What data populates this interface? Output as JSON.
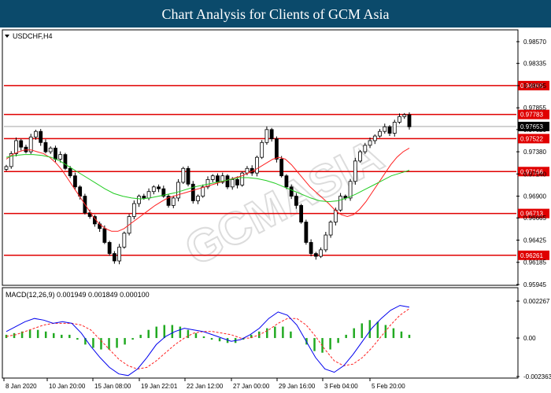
{
  "header": {
    "title": "Chart Analysis for Clients of GCM Asia"
  },
  "watermark": "GCMASIA",
  "colors": {
    "header_bg": "#0b4a6b",
    "level_line": "#e00000",
    "ma_fast": "#ff2020",
    "ma_slow": "#22cc22",
    "signal": "#ff2020",
    "macd_line": "#0000ee",
    "histogram": "#22aa22",
    "candle_up": "#ffffff",
    "candle_down": "#000000"
  },
  "chart_data": [
    {
      "type": "candlestick",
      "symbol_label": "USDCHF,H4",
      "ylim": [
        0.95945,
        0.9857
      ],
      "price_ticks": [
        0.9857,
        0.98335,
        0.98095,
        0.97855,
        0.9762,
        0.9738,
        0.9714,
        0.969,
        0.96665,
        0.96425,
        0.96185,
        0.95945
      ],
      "price_tick_labels": [
        "0.98570",
        "0.98335",
        "0.98095",
        "0.97855",
        "0.97620",
        "0.97380",
        "0.97140",
        "0.96900",
        "0.96665",
        "0.96425",
        "0.96185",
        "0.95945"
      ],
      "levels": [
        {
          "value": 0.98095,
          "label": "0.98095"
        },
        {
          "value": 0.97783,
          "label": "0.97783"
        },
        {
          "value": 0.97522,
          "label": "0.97522"
        },
        {
          "value": 0.97166,
          "label": "0.97166"
        },
        {
          "value": 0.96713,
          "label": "0.96713"
        },
        {
          "value": 0.96261,
          "label": "0.96261"
        }
      ],
      "current_price": {
        "value": 0.97653,
        "label": "0.97653"
      },
      "x_labels": [
        "8 Jan 2020",
        "10 Jan 20:00",
        "15 Jan 08:00",
        "19 Jan 22:01",
        "22 Jan 12:00",
        "27 Jan 00:00",
        "29 Jan 16:00",
        "3 Feb 04:00",
        "5 Feb 20:00"
      ],
      "close_path": [
        0.9722,
        0.9736,
        0.975,
        0.9743,
        0.9738,
        0.9754,
        0.976,
        0.9748,
        0.9738,
        0.9742,
        0.973,
        0.9735,
        0.972,
        0.9712,
        0.97,
        0.969,
        0.9672,
        0.9668,
        0.966,
        0.9655,
        0.964,
        0.9628,
        0.962,
        0.9635,
        0.965,
        0.9668,
        0.9682,
        0.969,
        0.9688,
        0.9695,
        0.97,
        0.9698,
        0.969,
        0.968,
        0.9688,
        0.9705,
        0.972,
        0.9703,
        0.9685,
        0.969,
        0.97,
        0.9708,
        0.9712,
        0.9705,
        0.9712,
        0.97,
        0.9708,
        0.9702,
        0.9715,
        0.972,
        0.9715,
        0.9732,
        0.9748,
        0.9762,
        0.9752,
        0.973,
        0.9712,
        0.97,
        0.969,
        0.968,
        0.9662,
        0.964,
        0.9628,
        0.9625,
        0.9632,
        0.9648,
        0.9662,
        0.9675,
        0.969,
        0.9688,
        0.9706,
        0.9728,
        0.9738,
        0.9745,
        0.975,
        0.9755,
        0.976,
        0.9765,
        0.9758,
        0.977,
        0.9776,
        0.9778,
        0.9765
      ],
      "ma_fast": [
        0.973,
        0.9735,
        0.9738,
        0.974,
        0.974,
        0.9738,
        0.9736,
        0.9732,
        0.9726,
        0.9718,
        0.9708,
        0.9698,
        0.9688,
        0.9678,
        0.9668,
        0.966,
        0.9655,
        0.9652,
        0.9652,
        0.9655,
        0.966,
        0.9665,
        0.967,
        0.9675,
        0.968,
        0.9684,
        0.9688,
        0.969,
        0.9692,
        0.9694,
        0.9696,
        0.9698,
        0.97,
        0.9702,
        0.9704,
        0.9706,
        0.9708,
        0.971,
        0.9712,
        0.9715,
        0.9718,
        0.9722,
        0.9726,
        0.973,
        0.9732,
        0.973,
        0.9724,
        0.9716,
        0.9708,
        0.97,
        0.9694,
        0.9688,
        0.9682,
        0.9675,
        0.967,
        0.9668,
        0.967,
        0.9676,
        0.9684,
        0.9694,
        0.9704,
        0.9714,
        0.9724,
        0.9732,
        0.9738,
        0.9742
      ],
      "ma_slow": [
        0.9732,
        0.9734,
        0.9735,
        0.9735,
        0.9734,
        0.9732,
        0.9728,
        0.9722,
        0.9716,
        0.971,
        0.9704,
        0.9698,
        0.9693,
        0.969,
        0.9688,
        0.9687,
        0.9688,
        0.969,
        0.9692,
        0.9694,
        0.9697,
        0.97,
        0.9702,
        0.9704,
        0.9706,
        0.9708,
        0.971,
        0.971,
        0.9709,
        0.9707,
        0.9704,
        0.97,
        0.9696,
        0.9692,
        0.9688,
        0.9685,
        0.9684,
        0.9685,
        0.9688,
        0.9692,
        0.9697,
        0.9702,
        0.9707,
        0.9712,
        0.9715,
        0.9718
      ]
    },
    {
      "type": "macd",
      "label": "MACD(12,26,9) 0.001949 0.001849 0.000100",
      "ylim": [
        -0.00236,
        0.00227
      ],
      "y_ticks": [
        0.002267,
        0.0,
        -0.002363
      ],
      "y_tick_labels": [
        "0.002267",
        "0.00",
        "-0.002363"
      ],
      "macd_line": [
        0.0004,
        0.0007,
        0.001,
        0.0012,
        0.0011,
        0.0009,
        0.001,
        0.0009,
        0.0003,
        -0.0005,
        -0.0012,
        -0.0018,
        -0.0022,
        -0.0023,
        -0.0019,
        -0.0012,
        -0.0004,
        0.0001,
        0.0004,
        0.0006,
        0.0005,
        0.0004,
        0.0002,
        0.0,
        -0.0002,
        -0.0001,
        0.0002,
        0.0006,
        0.0012,
        0.0016,
        0.0014,
        0.0008,
        -0.0002,
        -0.0012,
        -0.0019,
        -0.0021,
        -0.0017,
        -0.001,
        -0.0002,
        0.0006,
        0.0012,
        0.0017,
        0.002,
        0.0019
      ],
      "signal_line": [
        0.0001,
        0.0002,
        0.0004,
        0.0006,
        0.0008,
        0.0009,
        0.0009,
        0.0009,
        0.0008,
        0.0005,
        -0.0001,
        -0.0007,
        -0.0013,
        -0.0017,
        -0.0019,
        -0.0018,
        -0.0014,
        -0.0009,
        -0.0004,
        0.0,
        0.0003,
        0.0004,
        0.0004,
        0.0003,
        0.0002,
        0.0,
        0.0,
        0.0002,
        0.0005,
        0.0009,
        0.0012,
        0.0012,
        0.0008,
        0.0001,
        -0.0007,
        -0.0014,
        -0.0017,
        -0.0016,
        -0.0012,
        -0.0006,
        0.0001,
        0.0008,
        0.0014,
        0.0018
      ],
      "histogram": [
        0.0002,
        0.0003,
        0.0004,
        0.0005,
        0.0005,
        0.0004,
        0.0003,
        0.0002,
        0.0002,
        -0.0001,
        -0.0004,
        -0.0006,
        -0.0007,
        -0.0007,
        -0.0006,
        -0.0004,
        -0.0001,
        0.0002,
        0.0005,
        0.0007,
        0.0008,
        0.0008,
        0.0007,
        0.0005,
        0.0003,
        0.0001,
        -0.0001,
        -0.0002,
        -0.0003,
        -0.0003,
        -0.0001,
        0.0002,
        0.0004,
        0.0006,
        0.0007,
        0.0007,
        0.0004,
        0.0,
        -0.0004,
        -0.0008,
        -0.0009,
        -0.0007,
        -0.0003,
        0.0002,
        0.0006,
        0.0009,
        0.0011,
        0.001,
        0.0008,
        0.0006,
        0.0004,
        0.0002
      ]
    }
  ]
}
